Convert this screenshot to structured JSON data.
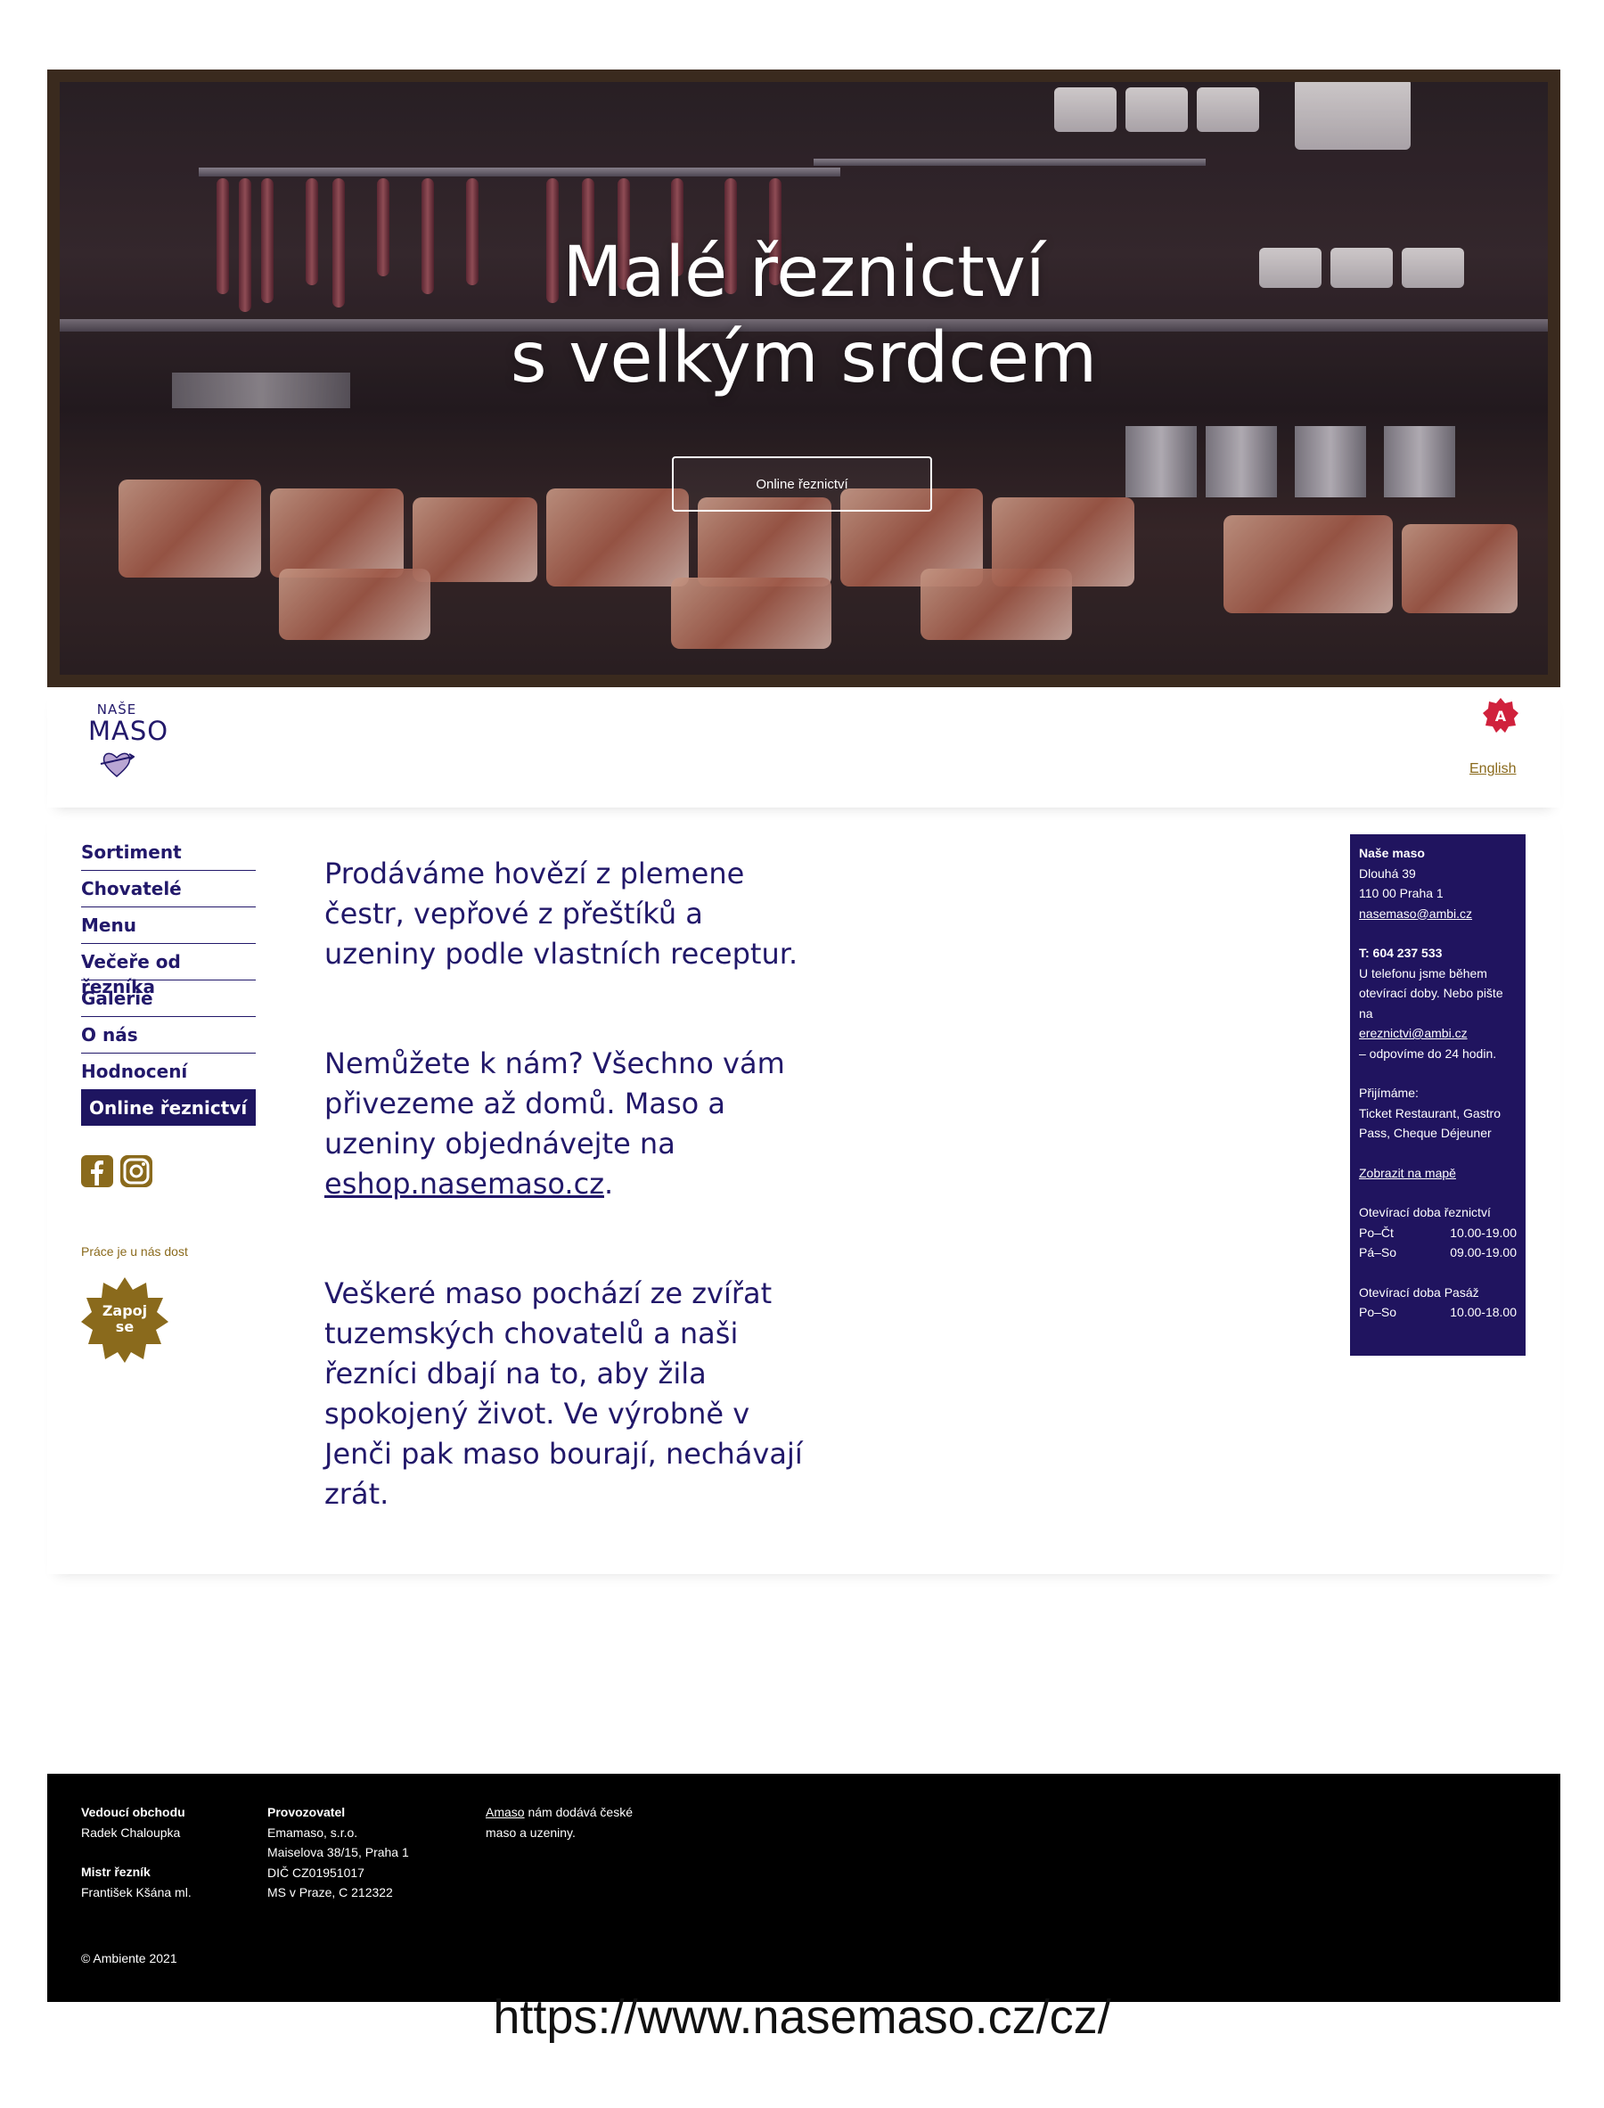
{
  "hero": {
    "title_line1": "Malé řeznictví",
    "title_line2": "s velkým srdcem",
    "button_label": "Online řeznictví"
  },
  "header": {
    "logo_small": "NAŠE",
    "logo_big": "MASO",
    "badge_letter": "A",
    "language_link": "English"
  },
  "nav": {
    "items": [
      "Sortiment",
      "Chovatelé",
      "Menu",
      "Večeře od řezníka",
      "Galerie",
      "O nás",
      "Hodnocení"
    ],
    "active_item": "Online řeznictví"
  },
  "sidebar_extra": {
    "jobs_text": "Práce je u nás dost",
    "join_line1": "Zapoj",
    "join_line2": "se"
  },
  "content": {
    "p1": "Prodáváme hovězí z plemene čestr, vepřové z přeštíků a uzeniny podle vlastních receptur.",
    "p2_before": "Nemůžete k nám? Všechno vám přivezeme až domů. Maso a uzeniny objednávejte na ",
    "p2_link": "eshop.nasemaso.cz",
    "p2_after": ".",
    "p3": "Veškeré maso pochází ze zvířat tuzemských chovatelů a naši řezníci dbají na to, aby žila spokojený život. Ve výrobně v Jenči pak maso bourají, nechávají zrát."
  },
  "info": {
    "name": "Naše maso",
    "street": "Dlouhá 39",
    "city": "110 00 Praha 1",
    "email": "nasemaso@ambi.cz",
    "phone": "T: 604 237 533",
    "phone_note": "U telefonu jsme během otevírací doby. Nebo pište na",
    "order_email": "ereznictvi@ambi.cz",
    "reply_note": " – odpovíme do 24 hodin.",
    "accept_label": "Přijímáme:",
    "accept_list": "Ticket Restaurant, Gastro Pass, Cheque Déjeuner",
    "map_link": "Zobrazit na mapě",
    "hours_shop_title": "Otevírací doba řeznictví",
    "hours_shop": [
      {
        "days": "Po–Čt",
        "time": "10.00-19.00"
      },
      {
        "days": "Pá–So",
        "time": "09.00-19.00"
      }
    ],
    "hours_passage_title": "Otevírací doba Pasáž",
    "hours_passage": [
      {
        "days": "Po–So",
        "time": "10.00-18.00"
      }
    ]
  },
  "footer": {
    "manager_title": "Vedoucí obchodu",
    "manager_name": "Radek Chaloupka",
    "butcher_title": "Mistr řezník",
    "butcher_name": "František Kšána ml.",
    "operator_title": "Provozovatel",
    "operator_lines": [
      "Emamaso, s.r.o.",
      "Maiselova 38/15, Praha 1",
      "DIČ CZ01951017",
      "MS v Praze, C 212322"
    ],
    "supplier_link": "Amaso",
    "supplier_text1": " nám dodává české",
    "supplier_text2": "maso a uzeniny.",
    "copyright": "© Ambiente 2021"
  },
  "url_caption": "https://www.nasemaso.cz/cz/",
  "colors": {
    "brand_navy": "#20145f",
    "gold": "#8a6a1c",
    "badge_red": "#d0213c",
    "footer_bg": "#000000"
  }
}
